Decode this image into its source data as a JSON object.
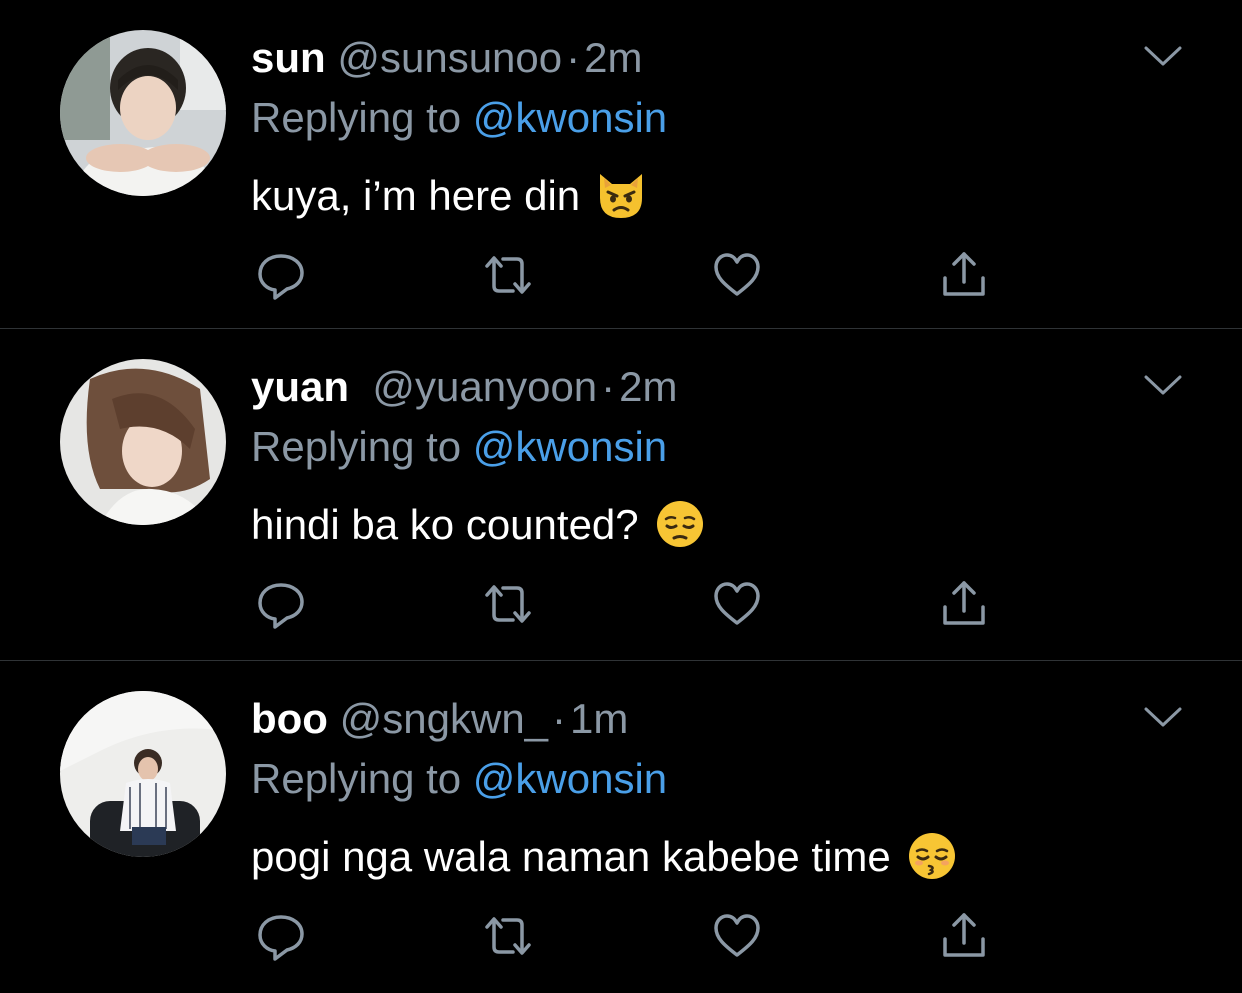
{
  "colors": {
    "background": "#000000",
    "divider": "#2f3336",
    "name": "#ffffff",
    "secondary": "#8b98a5",
    "mention": "#4a9fe8",
    "icon": "#8b98a5"
  },
  "tweets": [
    {
      "name": "sun",
      "handle": "@sunsunoo",
      "separator": "·",
      "time": "2m",
      "replying_label": "Replying to",
      "replying_to": "@kwonsin",
      "text": "kuya, i’m here din",
      "emoji": "pouting-cat-emoji",
      "avatar": "profile-photo-sun",
      "actions": [
        "reply-icon",
        "retweet-icon",
        "like-icon",
        "share-icon"
      ]
    },
    {
      "name": "yuan",
      "handle": "@yuanyoon",
      "separator": "·",
      "time": "2m",
      "replying_label": "Replying to",
      "replying_to": "@kwonsin",
      "text": "hindi ba ko counted?",
      "emoji": "pensive-face-emoji",
      "avatar": "profile-photo-yuan",
      "actions": [
        "reply-icon",
        "retweet-icon",
        "like-icon",
        "share-icon"
      ]
    },
    {
      "name": "boo",
      "handle": "@sngkwn_",
      "separator": "·",
      "time": "1m",
      "replying_label": "Replying to",
      "replying_to": "@kwonsin",
      "text": "pogi nga wala naman kabebe time",
      "emoji": "kissing-face-closed-eyes-emoji",
      "avatar": "profile-photo-boo",
      "actions": [
        "reply-icon",
        "retweet-icon",
        "like-icon",
        "share-icon"
      ]
    }
  ]
}
